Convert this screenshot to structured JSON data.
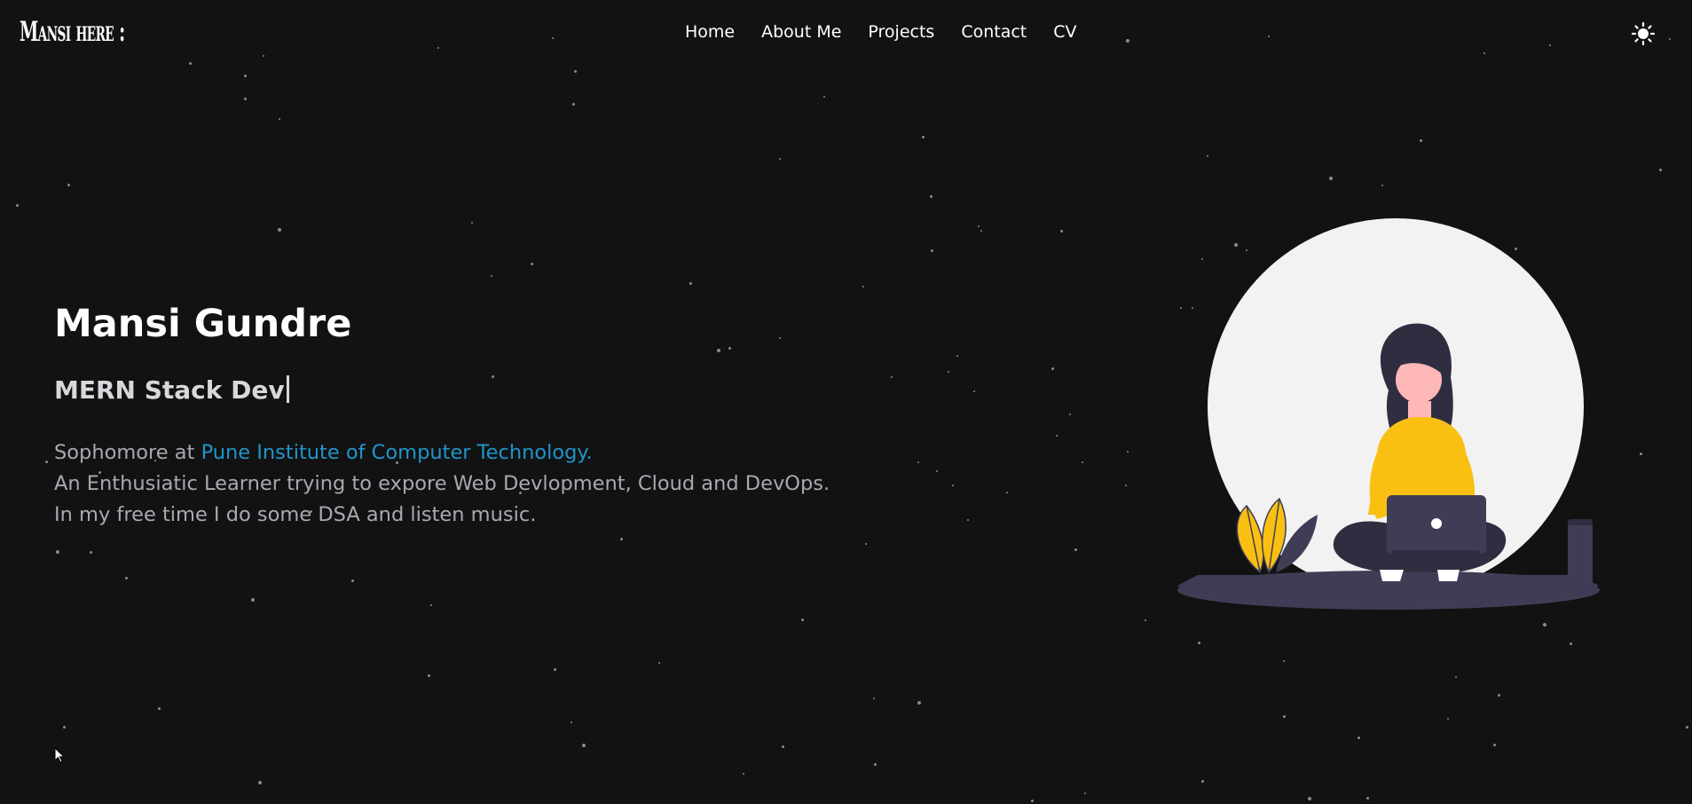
{
  "header": {
    "logo": "Mansi here :",
    "nav": [
      {
        "label": "Home"
      },
      {
        "label": "About Me"
      },
      {
        "label": "Projects"
      },
      {
        "label": "Contact"
      },
      {
        "label": "CV"
      }
    ],
    "theme_toggle_icon": "sun-icon"
  },
  "hero": {
    "name": "Mansi Gundre",
    "role": "MERN Stack Dev",
    "line1_prefix": "Sophomore at ",
    "line1_link": "Pune Institute of Computer Technology.",
    "line2": "An Enthusiatic Learner trying to expore Web Devlopment, Cloud and DevOps.",
    "line3": "In my free time I do some DSA and listen music.",
    "illustration_icon": "woman-with-laptop-illustration"
  },
  "colors": {
    "background": "#121212",
    "text": "#ffffff",
    "muted": "#a7a9b3",
    "link": "#1f95c9",
    "accent_yellow": "#f9c012",
    "dark_figure": "#3f3d56",
    "circle": "#f2f2f2"
  }
}
